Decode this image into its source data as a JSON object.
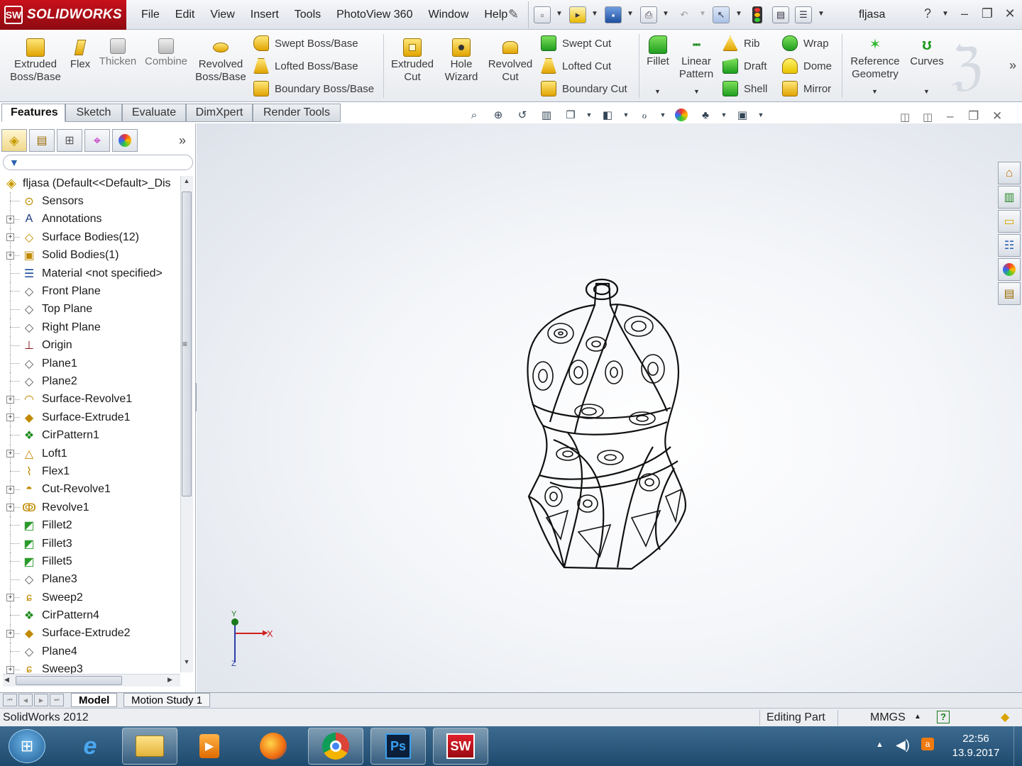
{
  "app": {
    "logo_text": "SOLIDWORKS",
    "menu": [
      "File",
      "Edit",
      "View",
      "Insert",
      "Tools",
      "PhotoView 360",
      "Window",
      "Help"
    ],
    "document_name": "fljasa"
  },
  "commands": {
    "extruded_boss": "Extruded Boss/Base",
    "flex": "Flex",
    "thicken": "Thicken",
    "combine": "Combine",
    "revolved_boss": "Revolved Boss/Base",
    "swept_boss": "Swept Boss/Base",
    "lofted_boss": "Lofted Boss/Base",
    "boundary_boss": "Boundary Boss/Base",
    "extruded_cut": "Extruded Cut",
    "hole_wizard": "Hole Wizard",
    "revolved_cut": "Revolved Cut",
    "swept_cut": "Swept Cut",
    "lofted_cut": "Lofted Cut",
    "boundary_cut": "Boundary Cut",
    "fillet": "Fillet",
    "linear_pattern": "Linear Pattern",
    "rib": "Rib",
    "draft": "Draft",
    "shell": "Shell",
    "wrap": "Wrap",
    "dome": "Dome",
    "mirror": "Mirror",
    "reference_geometry": "Reference Geometry",
    "curves": "Curves"
  },
  "tabs": [
    "Features",
    "Sketch",
    "Evaluate",
    "DimXpert",
    "Render Tools"
  ],
  "active_tab": "Features",
  "tree": {
    "root": "fljasa  (Default<<Default>_Dis",
    "items": [
      {
        "label": "Sensors",
        "icon": "sensor-icon",
        "expandable": false
      },
      {
        "label": "Annotations",
        "icon": "annotation-icon",
        "expandable": true
      },
      {
        "label": "Surface Bodies(12)",
        "icon": "surface-bodies-icon",
        "expandable": true
      },
      {
        "label": "Solid Bodies(1)",
        "icon": "solid-bodies-icon",
        "expandable": true
      },
      {
        "label": "Material <not specified>",
        "icon": "material-icon",
        "expandable": false
      },
      {
        "label": "Front Plane",
        "icon": "plane-icon",
        "expandable": false
      },
      {
        "label": "Top Plane",
        "icon": "plane-icon",
        "expandable": false
      },
      {
        "label": "Right Plane",
        "icon": "plane-icon",
        "expandable": false
      },
      {
        "label": "Origin",
        "icon": "origin-icon",
        "expandable": false
      },
      {
        "label": "Plane1",
        "icon": "plane-icon",
        "expandable": false
      },
      {
        "label": "Plane2",
        "icon": "plane-icon",
        "expandable": false
      },
      {
        "label": "Surface-Revolve1",
        "icon": "surface-revolve-icon",
        "expandable": true
      },
      {
        "label": "Surface-Extrude1",
        "icon": "surface-extrude-icon",
        "expandable": true
      },
      {
        "label": "CirPattern1",
        "icon": "circular-pattern-icon",
        "expandable": false
      },
      {
        "label": "Loft1",
        "icon": "loft-icon",
        "expandable": true
      },
      {
        "label": "Flex1",
        "icon": "flex-icon",
        "expandable": false
      },
      {
        "label": "Cut-Revolve1",
        "icon": "cut-revolve-icon",
        "expandable": true
      },
      {
        "label": "Revolve1",
        "icon": "revolve-icon",
        "expandable": true
      },
      {
        "label": "Fillet2",
        "icon": "fillet-icon",
        "expandable": false
      },
      {
        "label": "Fillet3",
        "icon": "fillet-icon",
        "expandable": false
      },
      {
        "label": "Fillet5",
        "icon": "fillet-icon",
        "expandable": false
      },
      {
        "label": "Plane3",
        "icon": "plane-icon",
        "expandable": false
      },
      {
        "label": "Sweep2",
        "icon": "sweep-icon",
        "expandable": true
      },
      {
        "label": "CirPattern4",
        "icon": "circular-pattern-icon",
        "expandable": false
      },
      {
        "label": "Surface-Extrude2",
        "icon": "surface-extrude-icon",
        "expandable": true
      },
      {
        "label": "Plane4",
        "icon": "plane-icon",
        "expandable": false
      },
      {
        "label": "Sweep3",
        "icon": "sweep-icon",
        "expandable": true
      }
    ]
  },
  "bottom_tabs": [
    "Model",
    "Motion Study 1"
  ],
  "status": {
    "app_version": "SolidWorks 2012",
    "mode": "Editing Part",
    "units": "MMGS"
  },
  "triad": {
    "x": "X",
    "y": "Y",
    "z": "Z"
  },
  "taskbar": {
    "time": "22:56",
    "date": "13.9.2017"
  },
  "colors": {
    "brand": "#c8101b",
    "feature_yellow": "#f2c200",
    "feature_green": "#2fb82f"
  }
}
